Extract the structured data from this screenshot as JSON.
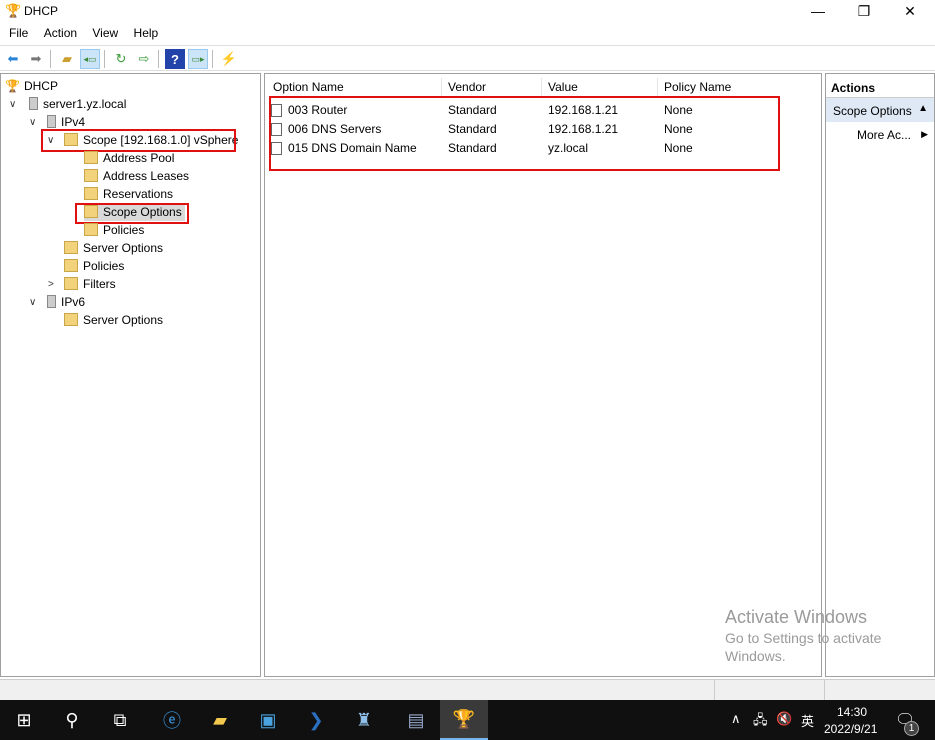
{
  "window": {
    "title": "DHCP",
    "minimize": "—",
    "restore": "❐",
    "close": "✕"
  },
  "menu": [
    "File",
    "Action",
    "View",
    "Help"
  ],
  "toolbar": {
    "icons": [
      "back-icon",
      "forward-icon",
      "up-folder-icon",
      "show-hide-tree-icon",
      "refresh-icon",
      "export-list-icon",
      "help-icon",
      "show-hide-action-pane-icon",
      "dhcp-wizard-icon"
    ]
  },
  "tree": {
    "root": "DHCP",
    "server": "server1.yz.local",
    "ipv4": "IPv4",
    "scope": "Scope [192.168.1.0] vSphere",
    "scope_children": [
      "Address Pool",
      "Address Leases",
      "Reservations",
      "Scope Options",
      "Policies"
    ],
    "ipv4_children": [
      "Server Options",
      "Policies",
      "Filters"
    ],
    "ipv6": "IPv6",
    "ipv6_children": [
      "Server Options"
    ]
  },
  "list": {
    "columns": [
      "Option Name",
      "Vendor",
      "Value",
      "Policy Name"
    ],
    "rows": [
      {
        "name": "003 Router",
        "vendor": "Standard",
        "value": "192.168.1.21",
        "policy": "None"
      },
      {
        "name": "006 DNS Servers",
        "vendor": "Standard",
        "value": "192.168.1.21",
        "policy": "None"
      },
      {
        "name": "015 DNS Domain Name",
        "vendor": "Standard",
        "value": "yz.local",
        "policy": "None"
      }
    ]
  },
  "actions": {
    "title": "Actions",
    "section": "Scope Options",
    "more": "More Ac..."
  },
  "watermark": {
    "line1": "Activate Windows",
    "line2": "Go to Settings to activate",
    "line3": "Windows."
  },
  "taskbar": {
    "time": "14:30",
    "date": "2022/9/21",
    "ime": "英",
    "notifications": "1"
  }
}
